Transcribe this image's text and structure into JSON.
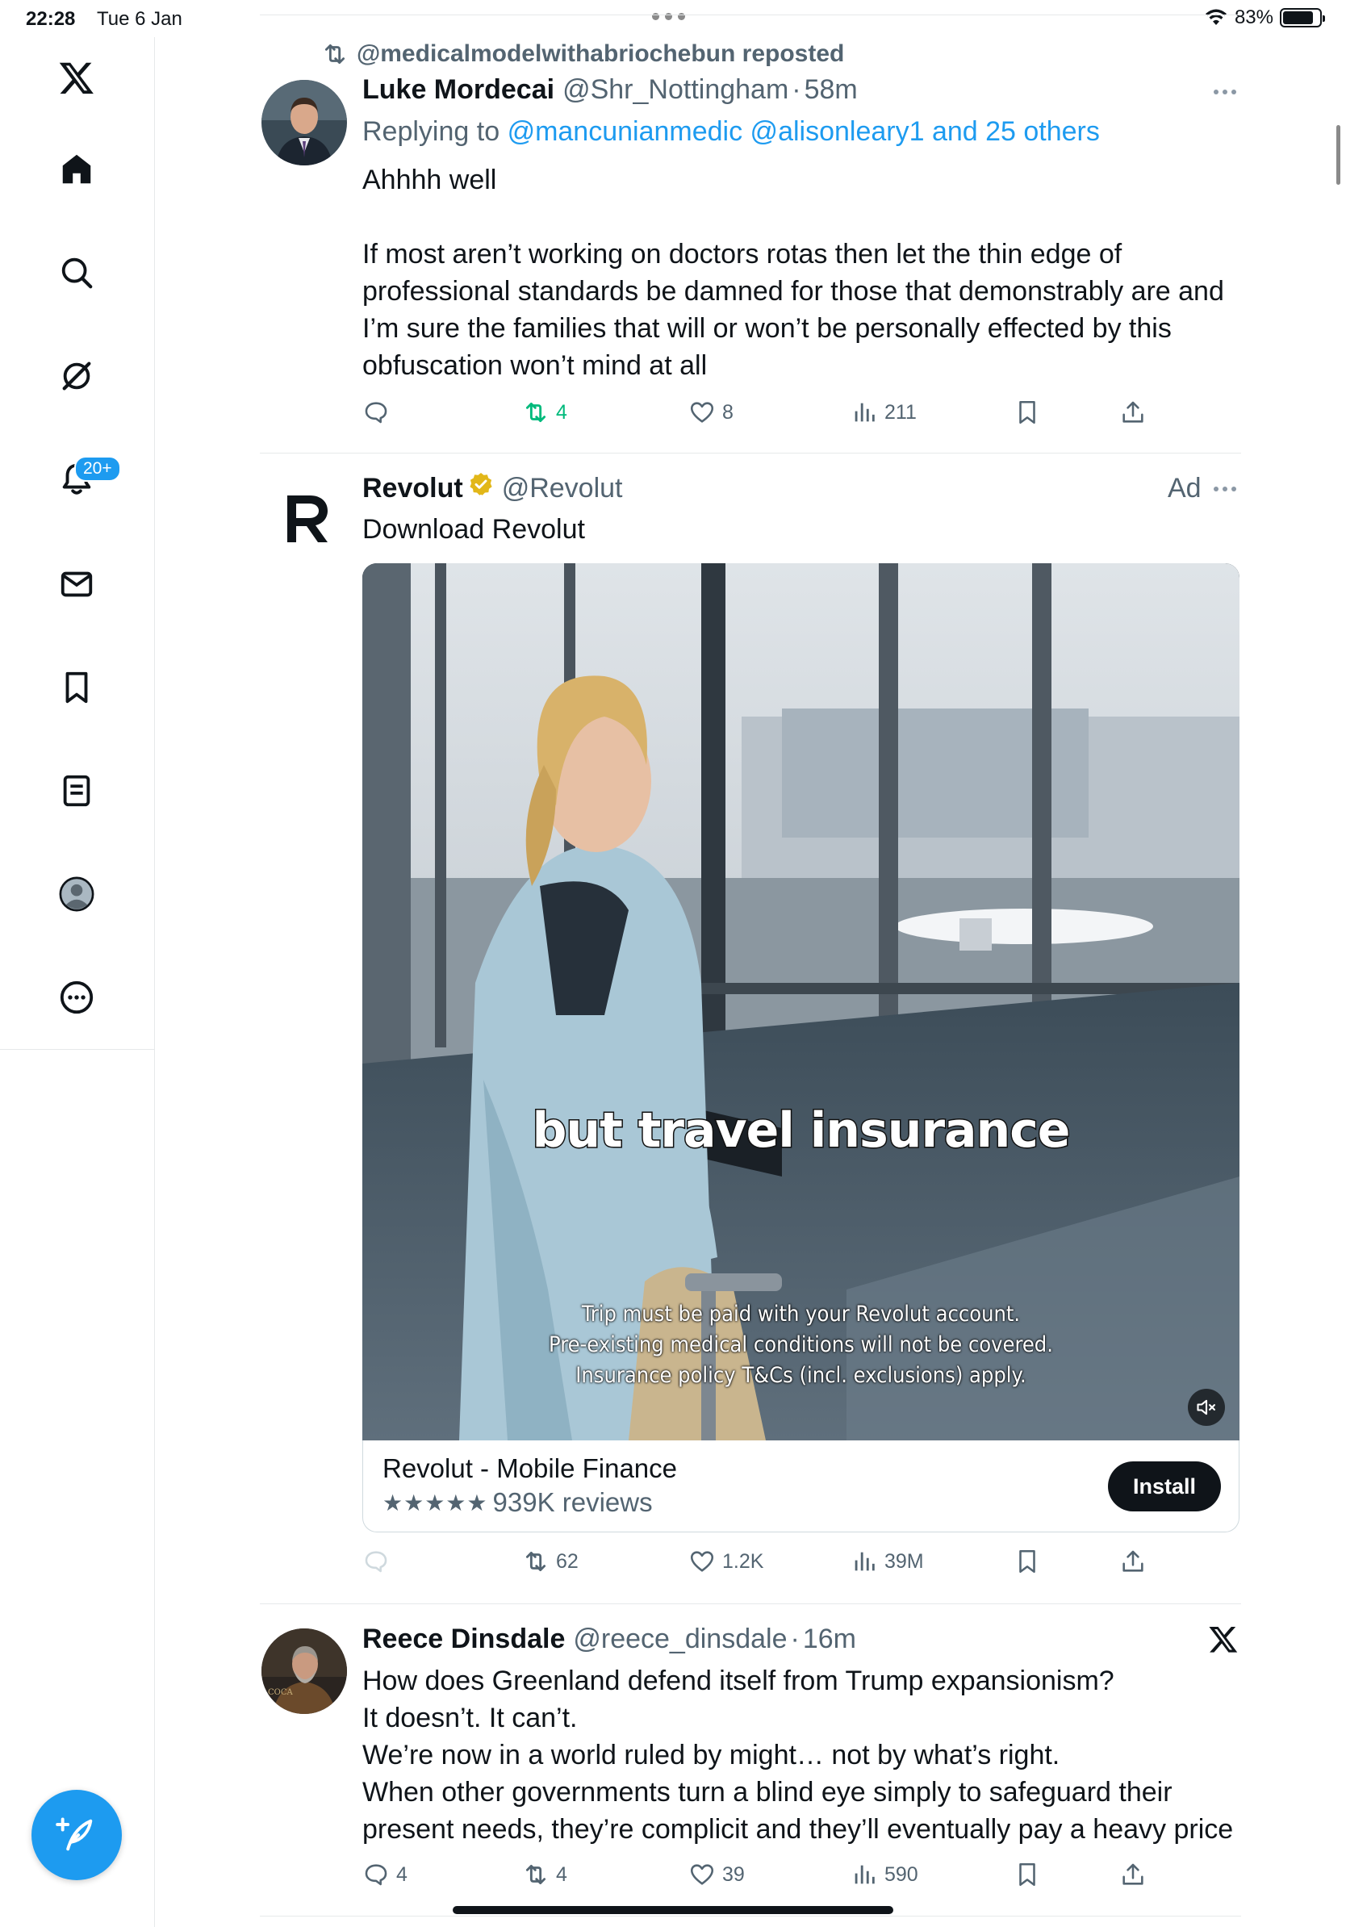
{
  "status_bar": {
    "time": "22:28",
    "date": "Tue 6 Jan",
    "battery_percent": "83%",
    "battery_level": 0.83
  },
  "nav": {
    "items": [
      {
        "name": "x-logo-icon"
      },
      {
        "name": "home-icon"
      },
      {
        "name": "search-icon"
      },
      {
        "name": "grok-icon"
      },
      {
        "name": "notifications-icon"
      },
      {
        "name": "messages-icon"
      },
      {
        "name": "bookmarks-icon"
      },
      {
        "name": "lists-icon"
      },
      {
        "name": "profile-icon"
      },
      {
        "name": "more-icon"
      }
    ],
    "notifications_badge": "20+"
  },
  "tweets": [
    {
      "repost_label": "@medicalmodelwithabriochebun reposted",
      "name": "Luke Mordecai",
      "handle": "@Shr_Nottingham",
      "sep": "·",
      "time": "58m",
      "replying_prefix": "Replying to",
      "replying_to": "@mancunianmedic @alisonleary1 and 25 others",
      "body": [
        "Ahhhh well",
        "",
        "If most aren’t working on doctors rotas then let the thin edge of professional standards be damned for those that demonstrably are and I’m sure the families that will or won’t be personally effected by this obfuscation won’t mind at all"
      ],
      "actions": {
        "replies": "",
        "reposts": "4",
        "likes": "8",
        "views": "211"
      }
    },
    {
      "name": "Revolut",
      "handle": "@Revolut",
      "ad_label": "Ad",
      "body": [
        "Download Revolut"
      ],
      "video_caption": "but travel insurance",
      "video_disclaimer": [
        "Trip must be paid with your Revolut account.",
        "Pre-existing medical conditions will not be covered.",
        "Insurance policy T&Cs (incl. exclusions) apply."
      ],
      "card": {
        "title": "Revolut - Mobile Finance",
        "stars": "★★★★★",
        "reviews": "939K reviews",
        "install": "Install"
      },
      "actions": {
        "replies": "",
        "reposts": "62",
        "likes": "1.2K",
        "views": "39M"
      }
    },
    {
      "name": "Reece Dinsdale",
      "handle": "@reece_dinsdale",
      "sep": "·",
      "time": "16m",
      "body": [
        "How does Greenland defend itself from Trump expansionism?",
        "It doesn’t. It can’t.",
        "We’re now in a world ruled by might… not by what’s right.",
        "When other governments turn a blind eye simply to safeguard their present needs, they’re complicit and they’ll eventually pay a heavy price"
      ],
      "actions": {
        "replies": "4",
        "reposts": "4",
        "likes": "39",
        "views": "590"
      }
    }
  ],
  "colors": {
    "accent": "#1d9bf0",
    "repost_green": "#00ba7c",
    "text_secondary": "#536471",
    "verified_gold": "#e2b719"
  }
}
